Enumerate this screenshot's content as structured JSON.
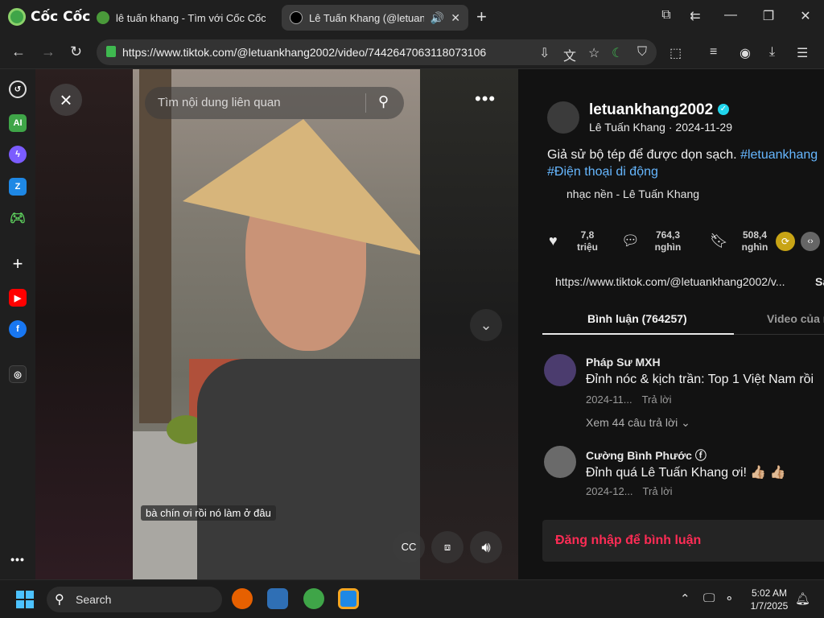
{
  "browser": {
    "brand": "Cốc Cốc",
    "tabs": [
      {
        "title": "lê tuấn khang - Tìm với Cốc Cốc"
      },
      {
        "title": "Lê Tuấn Khang (@letuank"
      }
    ],
    "url": "https://www.tiktok.com/@letuankhang2002/video/7442647063118073106"
  },
  "video": {
    "search_placeholder": "Tìm nội dung liên quan",
    "caption": "bà chín ơi rồi nó làm ở đâu"
  },
  "post": {
    "username": "letuankhang2002",
    "subtitle": "Lê Tuấn Khang · 2024-11-29",
    "description": "Giả sử bộ tép để được dọn sạch.",
    "hashtag1": "#letuankhang",
    "hashtag2": "#Điện thoại di động",
    "music": "nhạc nền - Lê Tuấn Khang",
    "likes": "7,8 triệu",
    "comments_count": "764,3 nghìn",
    "saves": "508,4 nghìn",
    "link": "https://www.tiktok.com/@letuankhang2002/v...",
    "copy_label": "Sa"
  },
  "comment_tabs": {
    "comments": "Bình luận (764257)",
    "videos": "Video của n"
  },
  "comments": [
    {
      "name": "Pháp Sư MXH",
      "text": "Đỉnh nóc & kịch trần: Top 1 Việt Nam rồi",
      "date": "2024-11...",
      "reply": "Trả lời",
      "more": "Xem 44 câu trả lời ⌄"
    },
    {
      "name": "Cường Bình Phước ⓕ",
      "text": "Đỉnh quá Lê Tuấn Khang ơi! 👍🏼 👍🏼",
      "date": "2024-12...",
      "reply": "Trả lời"
    }
  ],
  "login_prompt": "Đăng nhập để bình luận",
  "taskbar": {
    "search": "Search",
    "time": "5:02 AM",
    "date": "1/7/2025"
  },
  "colors": {
    "accent_red": "#fe2c55",
    "hashtag_blue": "#66b7ff",
    "browser_green": "#3fa548"
  }
}
